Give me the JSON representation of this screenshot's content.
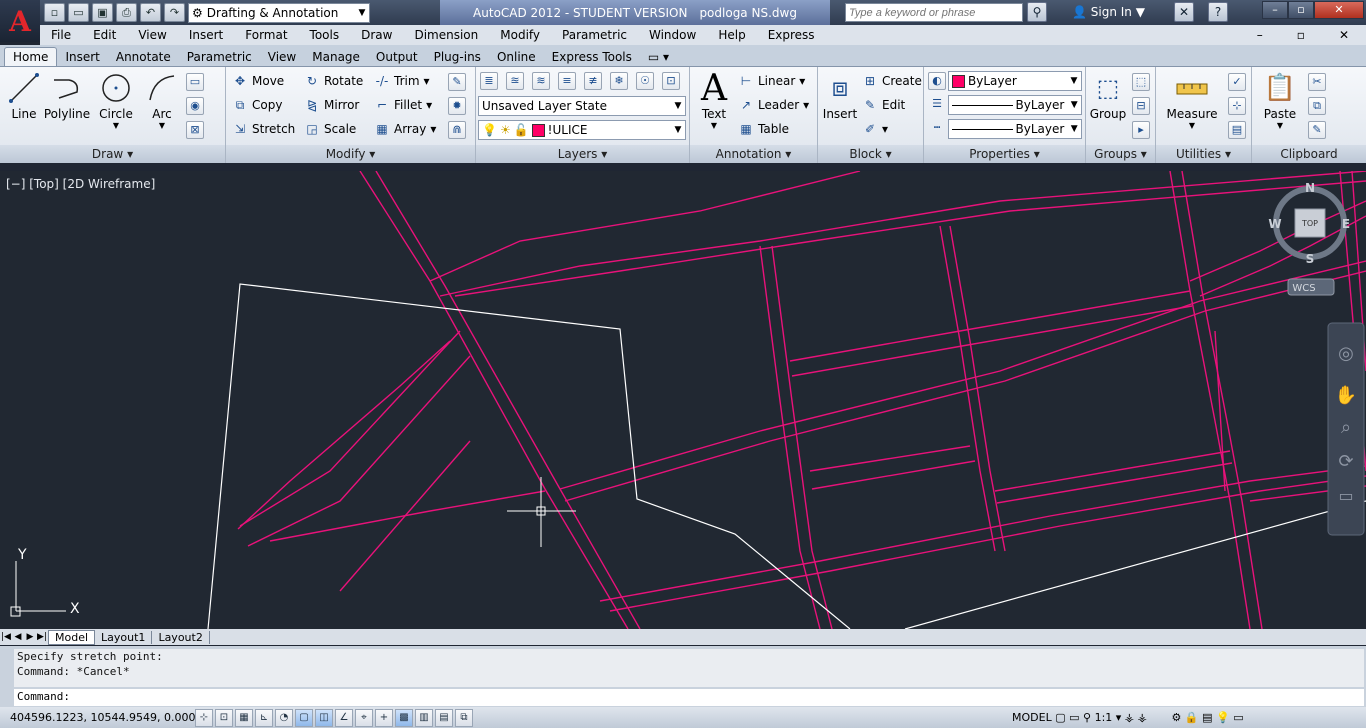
{
  "app": {
    "title": "AutoCAD 2012 - STUDENT VERSION",
    "file": "podloga NS.dwg",
    "logo": "A"
  },
  "quick_access": {
    "icons": [
      "new-icon",
      "open-icon",
      "save-icon",
      "print-icon",
      "undo-icon",
      "redo-icon"
    ],
    "workspace": "Drafting & Annotation"
  },
  "infocenter": {
    "search_placeholder": "Type a keyword or phrase",
    "sign_in": "Sign In"
  },
  "menubar": [
    "File",
    "Edit",
    "View",
    "Insert",
    "Format",
    "Tools",
    "Draw",
    "Dimension",
    "Modify",
    "Parametric",
    "Window",
    "Help",
    "Express"
  ],
  "ribbon_tabs": [
    "Home",
    "Insert",
    "Annotate",
    "Parametric",
    "View",
    "Manage",
    "Output",
    "Plug-ins",
    "Online",
    "Express Tools"
  ],
  "active_tab": "Home",
  "draw": {
    "title": "Draw",
    "line": "Line",
    "polyline": "Polyline",
    "circle": "Circle",
    "arc": "Arc"
  },
  "modify": {
    "title": "Modify",
    "move": "Move",
    "rotate": "Rotate",
    "trim": "Trim",
    "copy": "Copy",
    "mirror": "Mirror",
    "fillet": "Fillet",
    "stretch": "Stretch",
    "scale": "Scale",
    "array": "Array"
  },
  "layers": {
    "title": "Layers",
    "layer_state": "Unsaved Layer State",
    "current_layer": "!ULICE",
    "layer_color": "#ff0066"
  },
  "annotation": {
    "title": "Annotation",
    "text": "Text",
    "linear": "Linear",
    "leader": "Leader",
    "table": "Table"
  },
  "block": {
    "title": "Block",
    "insert": "Insert",
    "create": "Create",
    "edit": "Edit"
  },
  "properties": {
    "title": "Properties",
    "color": "ByLayer",
    "linetype": "ByLayer",
    "lineweight": "ByLayer"
  },
  "groups": {
    "title": "Groups",
    "group": "Group"
  },
  "utilities": {
    "title": "Utilities",
    "measure": "Measure"
  },
  "clipboard": {
    "title": "Clipboard",
    "paste": "Paste"
  },
  "viewport": {
    "label": "[−] [Top] [2D Wireframe]",
    "viewcube": {
      "n": "N",
      "s": "S",
      "e": "E",
      "w": "W",
      "face": "TOP",
      "ucs": "WCS"
    },
    "axis_y": "Y",
    "axis_x": "X",
    "line_color": "#e8127a",
    "boundary_color": "#ffffff"
  },
  "layout_tabs": [
    "Model",
    "Layout1",
    "Layout2"
  ],
  "command": {
    "history": [
      "Specify stretch point:",
      "Command: *Cancel*"
    ],
    "prompt": "Command:"
  },
  "status": {
    "coords": "404596.1223, 10544.9549, 0.0000",
    "model": "MODEL",
    "scale": "1:1"
  }
}
